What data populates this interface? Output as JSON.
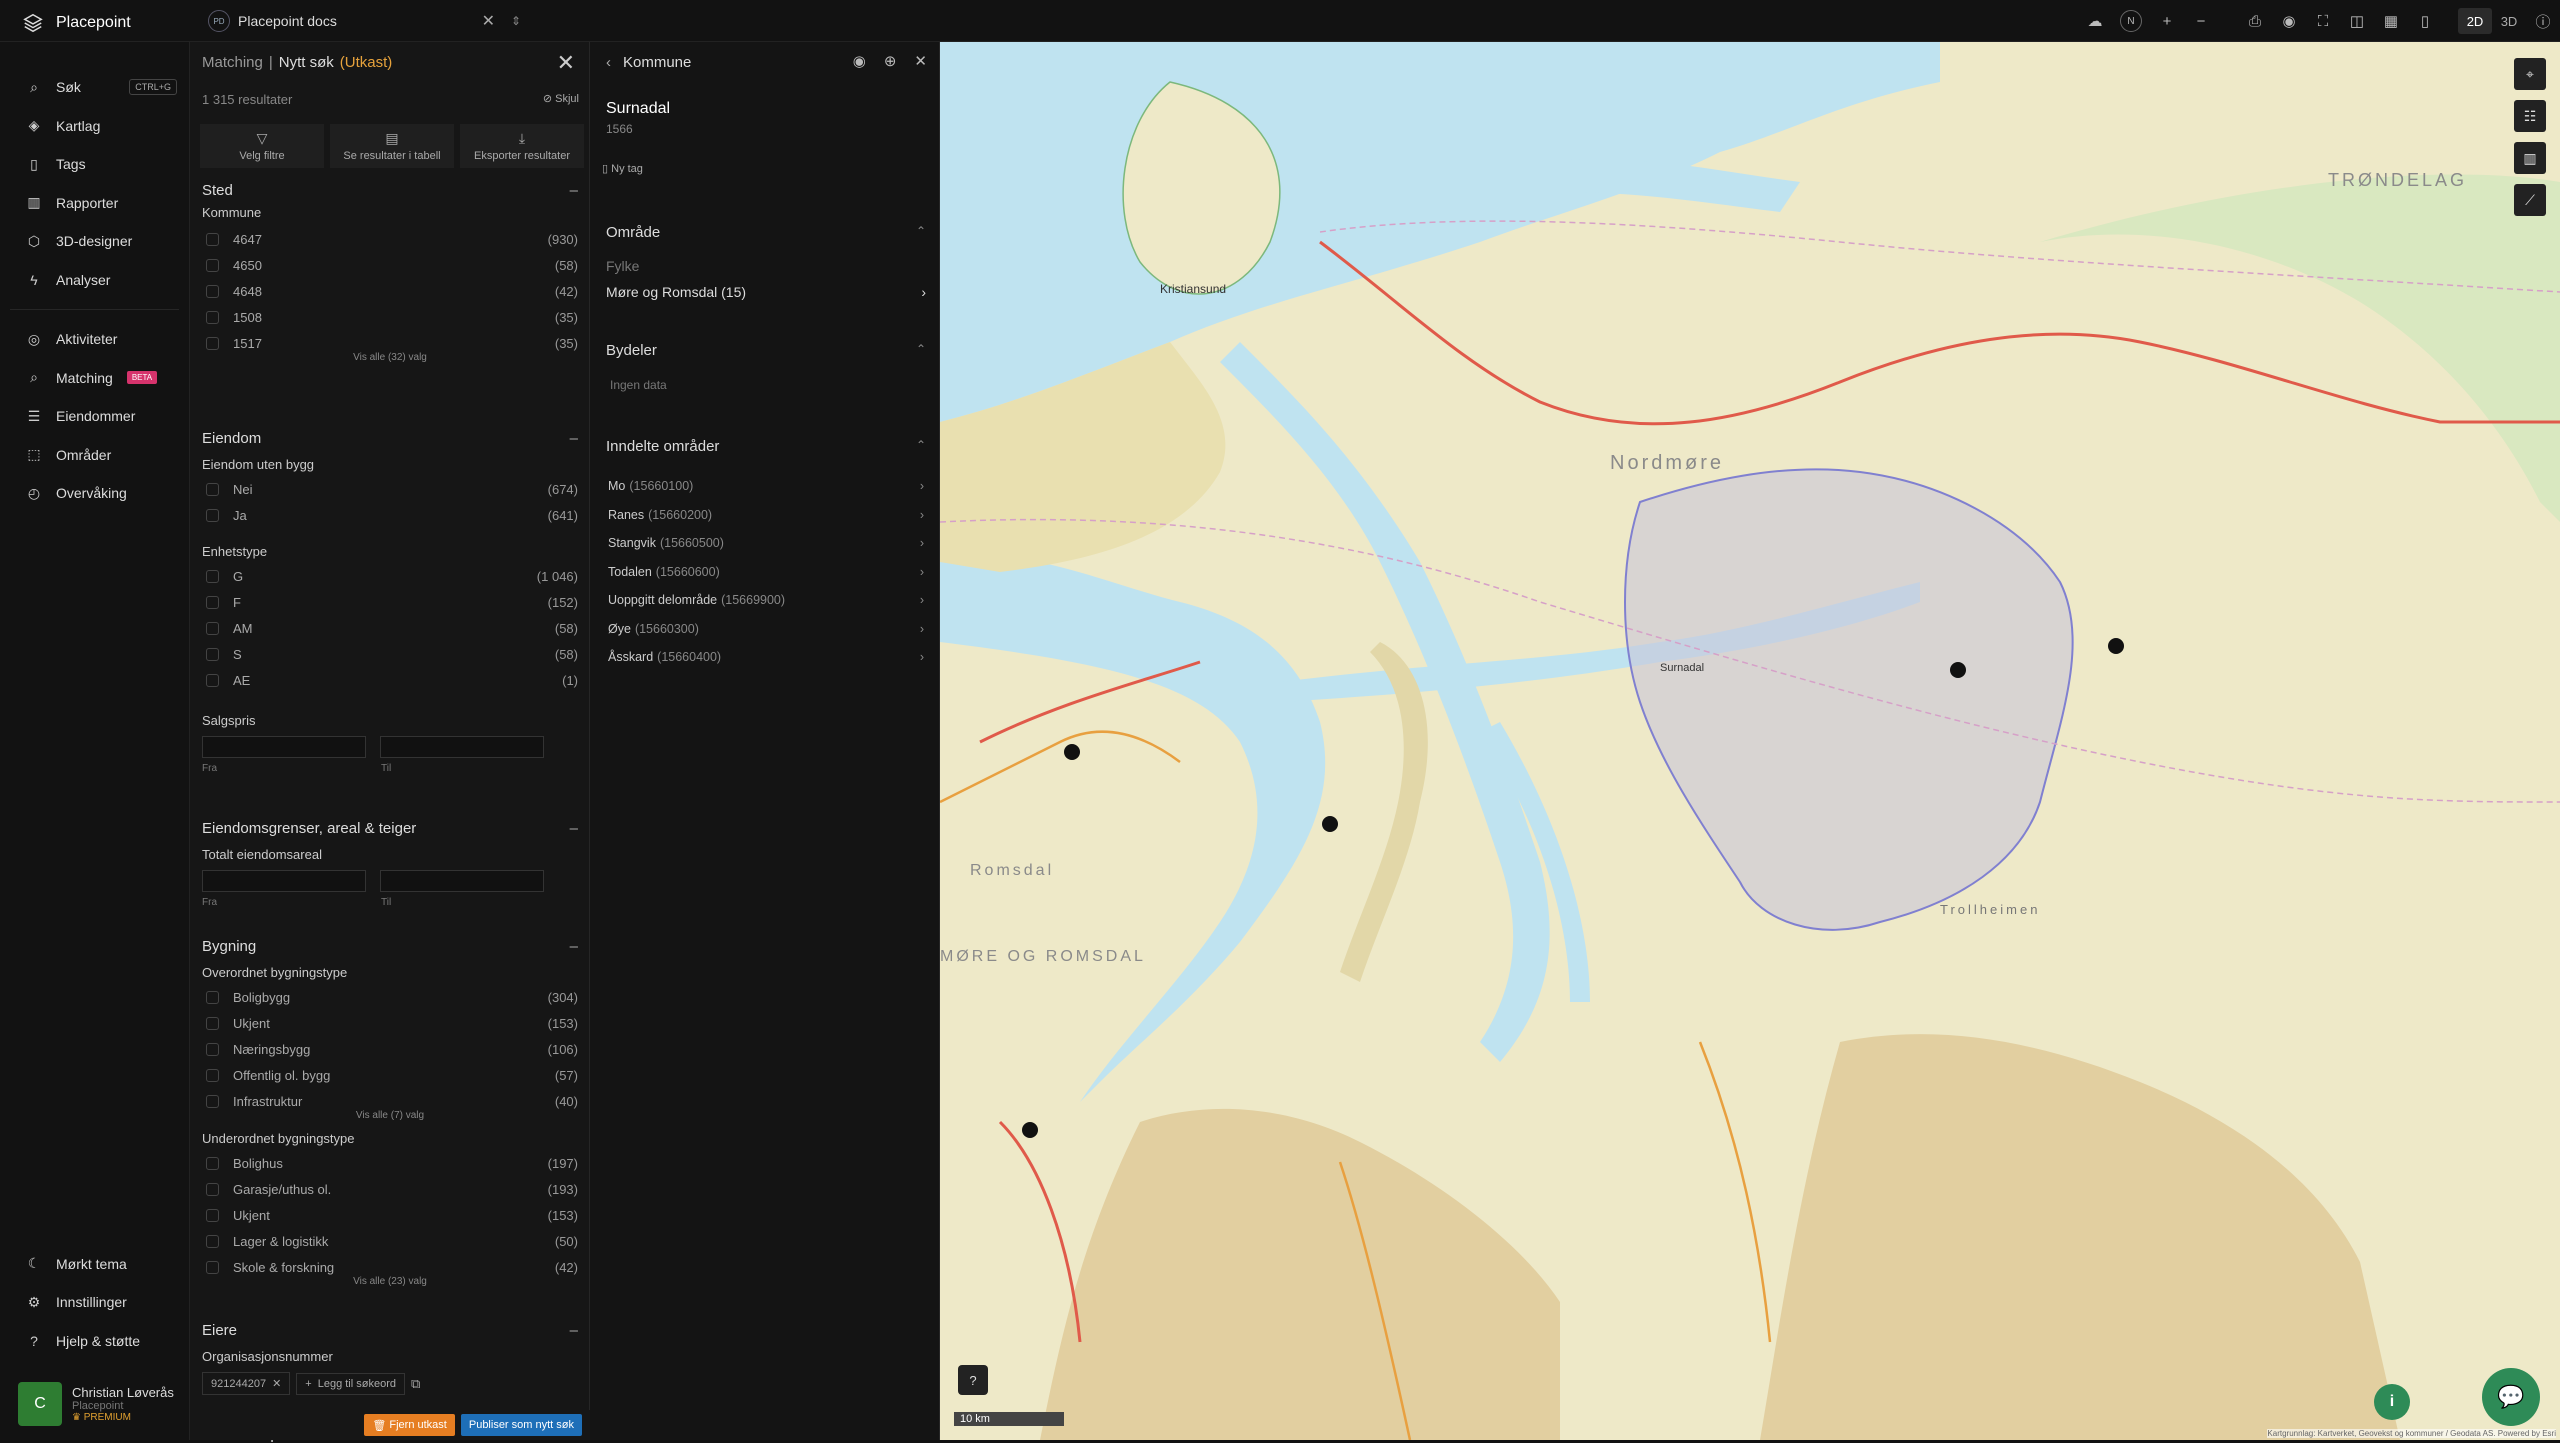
{
  "app": {
    "brand": "Placepoint"
  },
  "doc_selector": {
    "badge": "PD",
    "name": "Placepoint docs"
  },
  "toolbar": {
    "compass": "N",
    "mode_2d": "2D",
    "mode_3d": "3D"
  },
  "nav": {
    "items": [
      {
        "label": "Søk",
        "shortcut": "CTRL+G",
        "icon": "search-icon"
      },
      {
        "label": "Kartlag",
        "icon": "layers-icon"
      },
      {
        "label": "Tags",
        "icon": "bookmark-icon"
      },
      {
        "label": "Rapporter",
        "icon": "chart-icon"
      },
      {
        "label": "3D-designer",
        "icon": "cube-icon"
      },
      {
        "label": "Analyser",
        "icon": "bolt-icon"
      },
      {
        "label": "Aktiviteter",
        "icon": "activity-icon"
      },
      {
        "label": "Matching",
        "badge": "BETA",
        "icon": "match-icon"
      },
      {
        "label": "Eiendommer",
        "icon": "list-icon"
      },
      {
        "label": "Områder",
        "icon": "area-icon"
      },
      {
        "label": "Overvåking",
        "icon": "monitor-icon"
      }
    ],
    "bottom": [
      {
        "label": "Mørkt tema",
        "icon": "moon-icon"
      },
      {
        "label": "Innstillinger",
        "icon": "gear-icon"
      },
      {
        "label": "Hjelp & støtte",
        "icon": "help-icon"
      }
    ]
  },
  "user": {
    "initial": "C",
    "name": "Christian Løverås",
    "org": "Placepoint",
    "plan": "PREMIUM"
  },
  "filters": {
    "crumb": "Matching",
    "title": "Nytt søk",
    "status": "(Utkast)",
    "results": "1 315 resultater",
    "hide": "Skjul",
    "actions": [
      "Velg filtre",
      "Se resultater i tabell",
      "Eksporter resultater"
    ],
    "sted": {
      "title": "Sted",
      "sub": "Kommune",
      "rows": [
        {
          "l": "4647",
          "c": "(930)"
        },
        {
          "l": "4650",
          "c": "(58)"
        },
        {
          "l": "4648",
          "c": "(42)"
        },
        {
          "l": "1508",
          "c": "(35)"
        },
        {
          "l": "1517",
          "c": "(35)"
        }
      ],
      "more": "Vis alle (32) valg"
    },
    "eiendom": {
      "title": "Eiendom",
      "sub1": "Eiendom uten bygg",
      "rows1": [
        {
          "l": "Nei",
          "c": "(674)"
        },
        {
          "l": "Ja",
          "c": "(641)"
        }
      ],
      "sub2": "Enhetstype",
      "rows2": [
        {
          "l": "G",
          "c": "(1 046)"
        },
        {
          "l": "F",
          "c": "(152)"
        },
        {
          "l": "AM",
          "c": "(58)"
        },
        {
          "l": "S",
          "c": "(58)"
        },
        {
          "l": "AE",
          "c": "(1)"
        }
      ],
      "sub3": "Salgspris",
      "from": "Fra",
      "to": "Til"
    },
    "grenser": {
      "title": "Eiendomsgrenser, areal & teiger",
      "sub": "Totalt eiendomsareal",
      "from": "Fra",
      "to": "Til"
    },
    "bygning": {
      "title": "Bygning",
      "sub1": "Overordnet bygningstype",
      "rows1": [
        {
          "l": "Boligbygg",
          "c": "(304)"
        },
        {
          "l": "Ukjent",
          "c": "(153)"
        },
        {
          "l": "Næringsbygg",
          "c": "(106)"
        },
        {
          "l": "Offentlig ol. bygg",
          "c": "(57)"
        },
        {
          "l": "Infrastruktur",
          "c": "(40)"
        }
      ],
      "more1": "Vis alle (7) valg",
      "sub2": "Underordnet bygningstype",
      "rows2": [
        {
          "l": "Bolighus",
          "c": "(197)"
        },
        {
          "l": "Garasje/uthus ol.",
          "c": "(193)"
        },
        {
          "l": "Ukjent",
          "c": "(153)"
        },
        {
          "l": "Lager & logistikk",
          "c": "(50)"
        },
        {
          "l": "Skole & forskning",
          "c": "(42)"
        }
      ],
      "more2": "Vis alle (23) valg"
    },
    "eiere": {
      "title": "Eiere",
      "sub": "Organisasjonsnummer",
      "tag": "921244207",
      "add": "Legg til søkeord"
    },
    "kommuneplan": {
      "title": "Kommuneplan"
    },
    "remove": "Fjern utkast",
    "publish": "Publiser som nytt søk"
  },
  "detail": {
    "header": "Kommune",
    "name": "Surnadal",
    "code": "1566",
    "tag": "Ny tag",
    "omrade": {
      "title": "Område",
      "label": "Fylke",
      "value": "Møre og Romsdal (15)"
    },
    "bydeler": {
      "title": "Bydeler",
      "empty": "Ingen data"
    },
    "inndelte": {
      "title": "Inndelte områder",
      "items": [
        {
          "n": "Mo",
          "c": "(15660100)"
        },
        {
          "n": "Ranes",
          "c": "(15660200)"
        },
        {
          "n": "Stangvik",
          "c": "(15660500)"
        },
        {
          "n": "Todalen",
          "c": "(15660600)"
        },
        {
          "n": "Uoppgitt delområde",
          "c": "(15669900)"
        },
        {
          "n": "Øye",
          "c": "(15660300)"
        },
        {
          "n": "Åsskard",
          "c": "(15660400)"
        }
      ]
    }
  },
  "map": {
    "labels": [
      "TRØNDELAG",
      "Nordmøre",
      "Romsdal",
      "MØRE OG ROMSDAL",
      "Kristiansund",
      "Surnadal",
      "Trollheimen"
    ],
    "scale": "10 km",
    "attribution": "Kartgrunnlag: Kartverket, Geovekst og kommuner / Geodata AS. Powered by Esri"
  }
}
